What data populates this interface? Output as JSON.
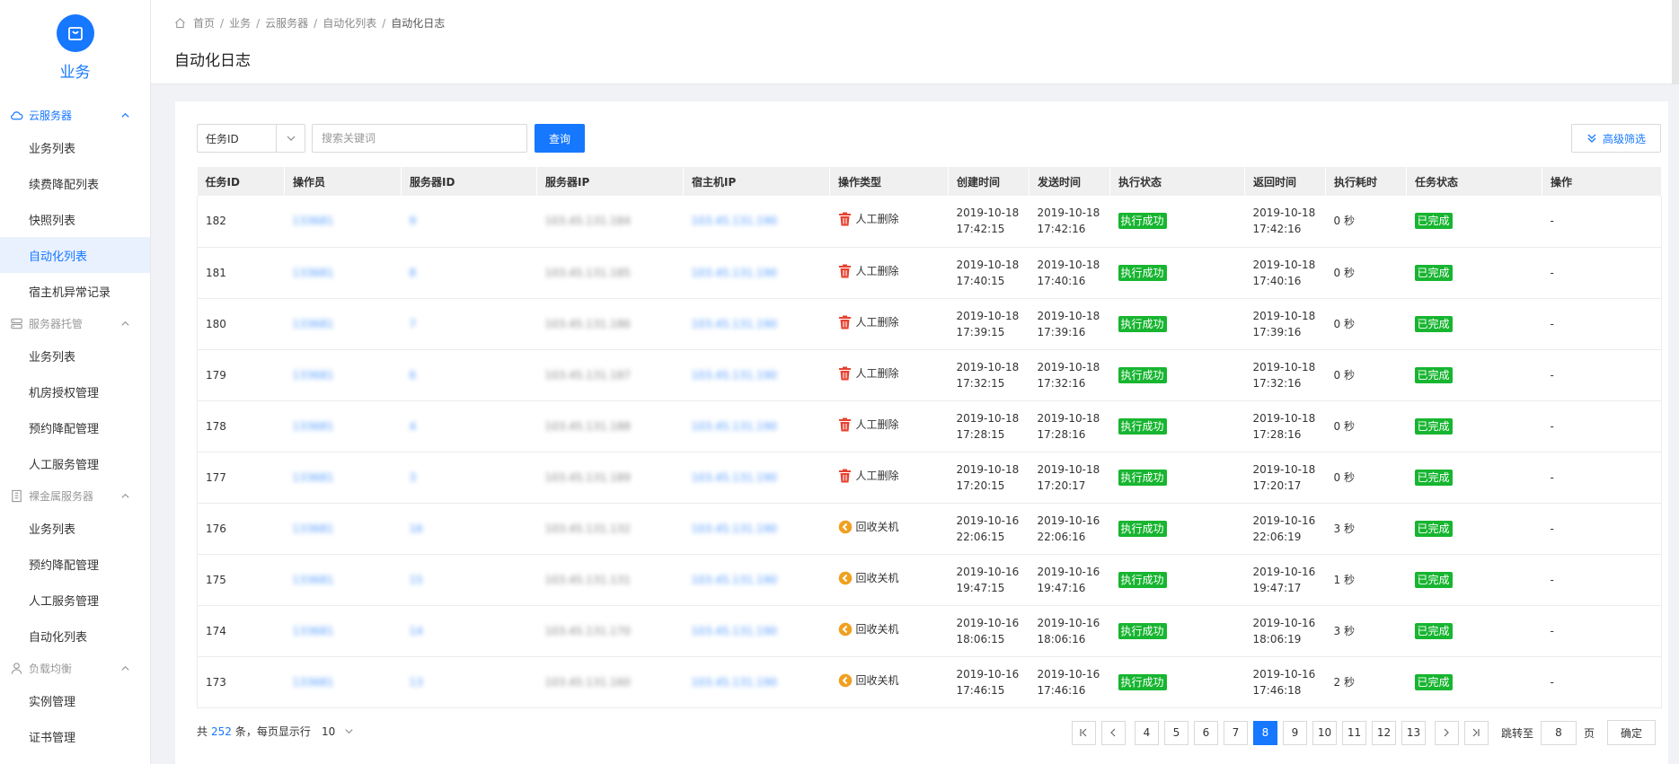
{
  "app": {
    "title": "业务"
  },
  "sidebar": {
    "groups": [
      {
        "label": "云服务器",
        "icon": "cloud-icon",
        "active": true,
        "items": [
          {
            "label": "业务列表",
            "active": false
          },
          {
            "label": "续费降配列表",
            "active": false
          },
          {
            "label": "快照列表",
            "active": false
          },
          {
            "label": "自动化列表",
            "active": true
          },
          {
            "label": "宿主机异常记录",
            "active": false
          }
        ]
      },
      {
        "label": "服务器托管",
        "icon": "server-icon",
        "active": false,
        "items": [
          {
            "label": "业务列表",
            "active": false
          },
          {
            "label": "机房授权管理",
            "active": false
          },
          {
            "label": "预约降配管理",
            "active": false
          },
          {
            "label": "人工服务管理",
            "active": false
          }
        ]
      },
      {
        "label": "裸金属服务器",
        "icon": "building-icon",
        "active": false,
        "items": [
          {
            "label": "业务列表",
            "active": false
          },
          {
            "label": "预约降配管理",
            "active": false
          },
          {
            "label": "人工服务管理",
            "active": false
          },
          {
            "label": "自动化列表",
            "active": false
          }
        ]
      },
      {
        "label": "负载均衡",
        "icon": "users-icon",
        "active": false,
        "items": [
          {
            "label": "实例管理",
            "active": false
          },
          {
            "label": "证书管理",
            "active": false
          }
        ]
      }
    ]
  },
  "breadcrumb": [
    "首页",
    "业务",
    "云服务器",
    "自动化列表",
    "自动化日志"
  ],
  "page_title": "自动化日志",
  "filter": {
    "select_value": "任务ID",
    "search_placeholder": "搜索关键词",
    "query_label": "查询",
    "advanced_label": "高级筛选"
  },
  "table": {
    "columns": [
      "任务ID",
      "操作员",
      "服务器ID",
      "服务器IP",
      "宿主机IP",
      "操作类型",
      "创建时间",
      "发送时间",
      "执行状态",
      "返回时间",
      "执行耗时",
      "任务状态",
      "操作"
    ],
    "rows": [
      {
        "id": "182",
        "operator": "133681",
        "server_id": "9",
        "server_ip": "103.45.131.184",
        "host_ip": "103.45.131.190",
        "op_type": "人工删除",
        "op_icon": "trash-icon",
        "created": [
          "2019-10-18",
          "17:42:15"
        ],
        "sent": [
          "2019-10-18",
          "17:42:16"
        ],
        "exec_status": "执行成功",
        "returned": [
          "2019-10-18",
          "17:42:16"
        ],
        "duration": "0 秒",
        "task_status": "已完成",
        "action": "-"
      },
      {
        "id": "181",
        "operator": "133681",
        "server_id": "8",
        "server_ip": "103.45.131.185",
        "host_ip": "103.45.131.190",
        "op_type": "人工删除",
        "op_icon": "trash-icon",
        "created": [
          "2019-10-18",
          "17:40:15"
        ],
        "sent": [
          "2019-10-18",
          "17:40:16"
        ],
        "exec_status": "执行成功",
        "returned": [
          "2019-10-18",
          "17:40:16"
        ],
        "duration": "0 秒",
        "task_status": "已完成",
        "action": "-"
      },
      {
        "id": "180",
        "operator": "133681",
        "server_id": "7",
        "server_ip": "103.45.131.186",
        "host_ip": "103.45.131.190",
        "op_type": "人工删除",
        "op_icon": "trash-icon",
        "created": [
          "2019-10-18",
          "17:39:15"
        ],
        "sent": [
          "2019-10-18",
          "17:39:16"
        ],
        "exec_status": "执行成功",
        "returned": [
          "2019-10-18",
          "17:39:16"
        ],
        "duration": "0 秒",
        "task_status": "已完成",
        "action": "-"
      },
      {
        "id": "179",
        "operator": "133681",
        "server_id": "6",
        "server_ip": "103.45.131.187",
        "host_ip": "103.45.131.190",
        "op_type": "人工删除",
        "op_icon": "trash-icon",
        "created": [
          "2019-10-18",
          "17:32:15"
        ],
        "sent": [
          "2019-10-18",
          "17:32:16"
        ],
        "exec_status": "执行成功",
        "returned": [
          "2019-10-18",
          "17:32:16"
        ],
        "duration": "0 秒",
        "task_status": "已完成",
        "action": "-"
      },
      {
        "id": "178",
        "operator": "133681",
        "server_id": "4",
        "server_ip": "103.45.131.188",
        "host_ip": "103.45.131.190",
        "op_type": "人工删除",
        "op_icon": "trash-icon",
        "created": [
          "2019-10-18",
          "17:28:15"
        ],
        "sent": [
          "2019-10-18",
          "17:28:16"
        ],
        "exec_status": "执行成功",
        "returned": [
          "2019-10-18",
          "17:28:16"
        ],
        "duration": "0 秒",
        "task_status": "已完成",
        "action": "-"
      },
      {
        "id": "177",
        "operator": "133681",
        "server_id": "3",
        "server_ip": "103.45.131.189",
        "host_ip": "103.45.131.190",
        "op_type": "人工删除",
        "op_icon": "trash-icon",
        "created": [
          "2019-10-18",
          "17:20:15"
        ],
        "sent": [
          "2019-10-18",
          "17:20:17"
        ],
        "exec_status": "执行成功",
        "returned": [
          "2019-10-18",
          "17:20:17"
        ],
        "duration": "0 秒",
        "task_status": "已完成",
        "action": "-"
      },
      {
        "id": "176",
        "operator": "133681",
        "server_id": "16",
        "server_ip": "103.45.131.132",
        "host_ip": "103.45.131.190",
        "op_type": "回收关机",
        "op_icon": "recycle-icon",
        "created": [
          "2019-10-16",
          "22:06:15"
        ],
        "sent": [
          "2019-10-16",
          "22:06:16"
        ],
        "exec_status": "执行成功",
        "returned": [
          "2019-10-16",
          "22:06:19"
        ],
        "duration": "3 秒",
        "task_status": "已完成",
        "action": "-"
      },
      {
        "id": "175",
        "operator": "133681",
        "server_id": "15",
        "server_ip": "103.45.131.131",
        "host_ip": "103.45.131.190",
        "op_type": "回收关机",
        "op_icon": "recycle-icon",
        "created": [
          "2019-10-16",
          "19:47:15"
        ],
        "sent": [
          "2019-10-16",
          "19:47:16"
        ],
        "exec_status": "执行成功",
        "returned": [
          "2019-10-16",
          "19:47:17"
        ],
        "duration": "1 秒",
        "task_status": "已完成",
        "action": "-"
      },
      {
        "id": "174",
        "operator": "133681",
        "server_id": "14",
        "server_ip": "103.45.131.170",
        "host_ip": "103.45.131.190",
        "op_type": "回收关机",
        "op_icon": "recycle-icon",
        "created": [
          "2019-10-16",
          "18:06:15"
        ],
        "sent": [
          "2019-10-16",
          "18:06:16"
        ],
        "exec_status": "执行成功",
        "returned": [
          "2019-10-16",
          "18:06:19"
        ],
        "duration": "3 秒",
        "task_status": "已完成",
        "action": "-"
      },
      {
        "id": "173",
        "operator": "133681",
        "server_id": "13",
        "server_ip": "103.45.131.160",
        "host_ip": "103.45.131.190",
        "op_type": "回收关机",
        "op_icon": "recycle-icon",
        "created": [
          "2019-10-16",
          "17:46:15"
        ],
        "sent": [
          "2019-10-16",
          "17:46:16"
        ],
        "exec_status": "执行成功",
        "returned": [
          "2019-10-16",
          "17:46:18"
        ],
        "duration": "2 秒",
        "task_status": "已完成",
        "action": "-"
      }
    ]
  },
  "footer": {
    "total_prefix": "共",
    "total": "252",
    "total_suffix": "条，每页显示行",
    "page_size": "10",
    "pages": [
      "4",
      "5",
      "6",
      "7",
      "8",
      "9",
      "10",
      "11",
      "12",
      "13"
    ],
    "current_page": "8",
    "jump_label": "跳转至",
    "jump_value": "8",
    "jump_unit": "页",
    "confirm_label": "确定"
  },
  "colors": {
    "accent": "#1677ff",
    "success": "#17b530",
    "danger": "#e8412f",
    "warning": "#f0a020"
  }
}
